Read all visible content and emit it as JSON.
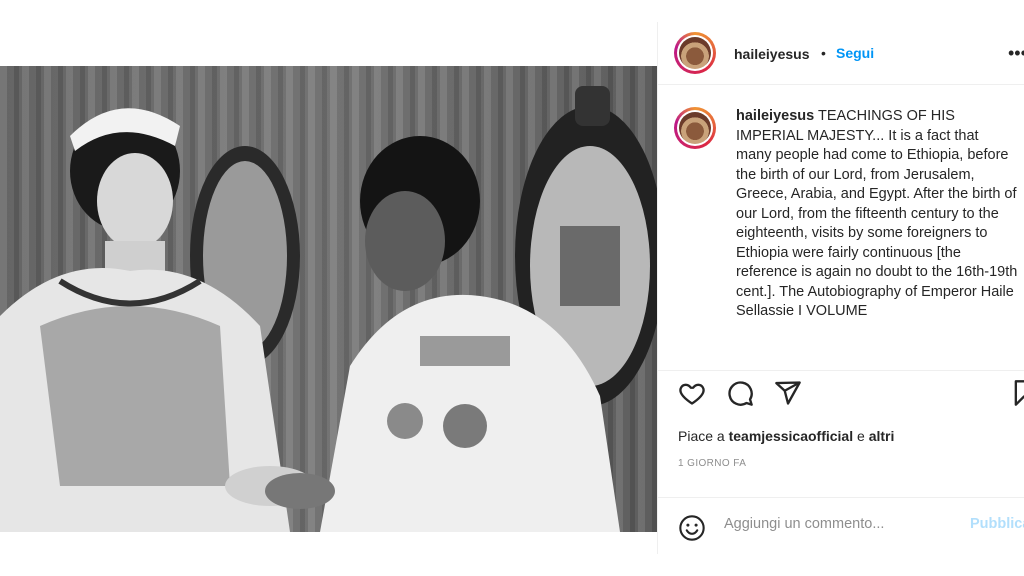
{
  "post": {
    "username": "haileiyesus",
    "follow_label": "Segui",
    "separator": "•",
    "caption_text": "TEACHINGS OF HIS IMPERIAL MAJESTY... It is a fact that many people had come to Ethiopia, before the birth of our Lord, from Jerusalem, Greece, Arabia, and Egypt. After the birth of our Lord, from the fifteenth century to the eighteenth, visits by some foreigners to Ethiopia were fairly continuous [the reference is again no doubt to the 16th-19th cent.]. The Autobiography of Emperor Haile Sellassie I VOLUME",
    "likes_prefix": "Piace a",
    "likes_user": "teamjessicaofficial",
    "likes_joiner": "e",
    "likes_others": "altri",
    "timestamp": "1 GIORNO FA",
    "comment_placeholder": "Aggiungi un commento...",
    "publish_label": "Pubblica"
  },
  "icons": {
    "like": "heart-icon",
    "comment": "comment-icon",
    "share": "share-icon",
    "save": "bookmark-icon",
    "emoji": "emoji-icon",
    "more": "more-icon"
  },
  "colors": {
    "accent": "#0095f6",
    "publish_disabled": "#b2dffc",
    "muted": "#8e8e8e",
    "text": "#262626"
  }
}
